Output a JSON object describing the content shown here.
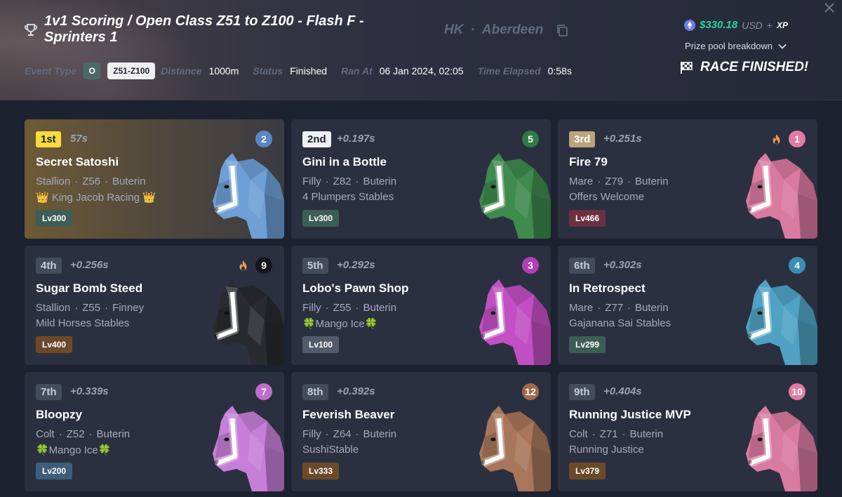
{
  "header": {
    "title": "1v1 Scoring / Open Class Z51 to Z100 - Flash F - Sprinters 1",
    "location_city": "HK",
    "location_dot": "·",
    "location_venue": "Aberdeen",
    "event_type_label": "Event Type",
    "class_badge": "O",
    "zrange_badge": "Z51-Z100",
    "distance_label": "Distance",
    "distance_value": "1000m",
    "status_label": "Status",
    "status_value": "Finished",
    "ran_at_label": "Ran At",
    "ran_at_value": "06 Jan 2024, 02:05",
    "elapsed_label": "Time Elapsed",
    "elapsed_value": "0:58s",
    "prize_amount": "$330.18",
    "prize_unit": "USD",
    "prize_plus": "+",
    "prize_xp": "XP",
    "prize_breakdown": "Prize pool breakdown",
    "race_status": "RACE FINISHED!"
  },
  "colors": {
    "accent_green": "#2fd39d",
    "first_badge": "#f6dc3c",
    "second_badge": "#eef0f4",
    "third_badge": "#bca37a",
    "other_badge": "#444b5c"
  },
  "results": [
    {
      "position": "1st",
      "time": "57s",
      "name": "Secret Satoshi",
      "gender": "Stallion",
      "zed": "Z56",
      "bloodline": "Buterin",
      "stable": "👑 King Jacob Racing 👑",
      "level": "Lv300",
      "gate": "2",
      "gate_color": "#5b87c4",
      "fire": false,
      "horse_color": "#6e9fd6",
      "level_color": "#3c5e54"
    },
    {
      "position": "2nd",
      "time": "+0.197s",
      "name": "Gini in a Bottle",
      "gender": "Filly",
      "zed": "Z82",
      "bloodline": "Buterin",
      "stable": "4 Plumpers Stables",
      "level": "Lv300",
      "gate": "5",
      "gate_color": "#2f7a45",
      "fire": false,
      "horse_color": "#3f8a4e",
      "level_color": "#3c5e54"
    },
    {
      "position": "3rd",
      "time": "+0.251s",
      "name": "Fire 79",
      "gender": "Mare",
      "zed": "Z79",
      "bloodline": "Buterin",
      "stable": "Offers Welcome",
      "level": "Lv466",
      "gate": "1",
      "gate_color": "#e27ba3",
      "fire": true,
      "horse_color": "#d97aa0",
      "level_color": "#6b3042"
    },
    {
      "position": "4th",
      "time": "+0.256s",
      "name": "Sugar Bomb Steed",
      "gender": "Stallion",
      "zed": "Z55",
      "bloodline": "Finney",
      "stable": "Mild Horses Stables",
      "level": "Lv400",
      "gate": "9",
      "gate_color": "#16171c",
      "fire": true,
      "horse_color": "#2a2b30",
      "level_color": "#6b4a2a"
    },
    {
      "position": "5th",
      "time": "+0.292s",
      "name": "Lobo's Pawn Shop",
      "gender": "Filly",
      "zed": "Z55",
      "bloodline": "Buterin",
      "stable": "🍀Mango Ice🍀",
      "level": "Lv100",
      "gate": "3",
      "gate_color": "#b13fb6",
      "fire": false,
      "horse_color": "#c24fc4",
      "level_color": "#535a6b"
    },
    {
      "position": "6th",
      "time": "+0.302s",
      "name": "In Retrospect",
      "gender": "Mare",
      "zed": "Z77",
      "bloodline": "Buterin",
      "stable": "Gajanana Sai Stables",
      "level": "Lv299",
      "gate": "4",
      "gate_color": "#3b8fb4",
      "fire": false,
      "horse_color": "#4fa2c4",
      "level_color": "#3c5e54"
    },
    {
      "position": "7th",
      "time": "+0.339s",
      "name": "Bloopzy",
      "gender": "Colt",
      "zed": "Z52",
      "bloodline": "Buterin",
      "stable": "🍀Mango Ice🍀",
      "level": "Lv200",
      "gate": "7",
      "gate_color": "#c16dd0",
      "fire": false,
      "horse_color": "#c67fd8",
      "level_color": "#3d5e7a"
    },
    {
      "position": "8th",
      "time": "+0.392s",
      "name": "Feverish Beaver",
      "gender": "Filly",
      "zed": "Z64",
      "bloodline": "Buterin",
      "stable": "SushiStable",
      "level": "Lv333",
      "gate": "12",
      "gate_color": "#a06a4c",
      "fire": false,
      "horse_color": "#a8765a",
      "level_color": "#6b4a2a"
    },
    {
      "position": "9th",
      "time": "+0.404s",
      "name": "Running Justice MVP",
      "gender": "Colt",
      "zed": "Z71",
      "bloodline": "Buterin",
      "stable": "Running Justice",
      "level": "Lv379",
      "gate": "10",
      "gate_color": "#e27ba3",
      "fire": false,
      "horse_color": "#d97aa0",
      "level_color": "#6b4a2a"
    }
  ]
}
